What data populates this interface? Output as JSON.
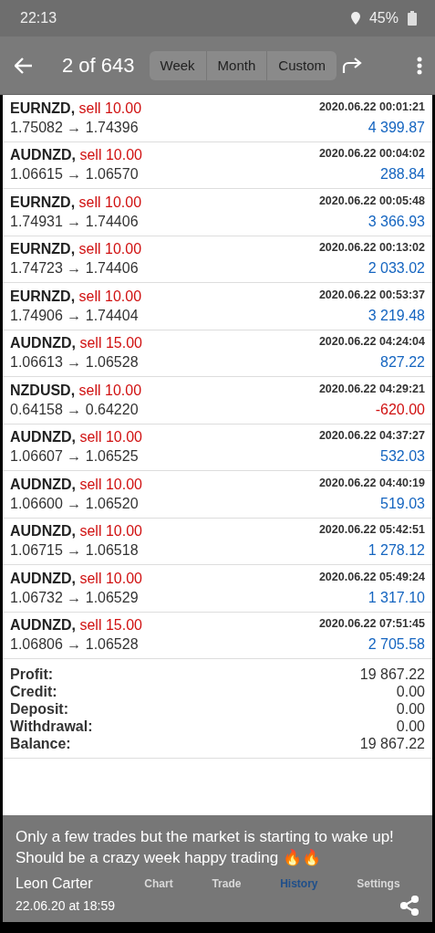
{
  "status_bar": {
    "time": "22:13",
    "battery": "45%"
  },
  "top_bar": {
    "counter": "2 of 643",
    "tabs": [
      {
        "label": "Week",
        "selected": false
      },
      {
        "label": "Month",
        "selected": false
      },
      {
        "label": "Custom",
        "selected": false
      }
    ]
  },
  "trades": [
    {
      "symbol": "EURNZD,",
      "action": "sell 10.00",
      "prices": "1.75082 → 1.74396",
      "time": "2020.06.22 00:01:21",
      "profit": "4 399.87",
      "negative": false
    },
    {
      "symbol": "AUDNZD,",
      "action": "sell 10.00",
      "prices": "1.06615 → 1.06570",
      "time": "2020.06.22 00:04:02",
      "profit": "288.84",
      "negative": false
    },
    {
      "symbol": "EURNZD,",
      "action": "sell 10.00",
      "prices": "1.74931 → 1.74406",
      "time": "2020.06.22 00:05:48",
      "profit": "3 366.93",
      "negative": false
    },
    {
      "symbol": "EURNZD,",
      "action": "sell 10.00",
      "prices": "1.74723 → 1.74406",
      "time": "2020.06.22 00:13:02",
      "profit": "2 033.02",
      "negative": false
    },
    {
      "symbol": "EURNZD,",
      "action": "sell 10.00",
      "prices": "1.74906 → 1.74404",
      "time": "2020.06.22 00:53:37",
      "profit": "3 219.48",
      "negative": false
    },
    {
      "symbol": "AUDNZD,",
      "action": "sell 15.00",
      "prices": "1.06613 → 1.06528",
      "time": "2020.06.22 04:24:04",
      "profit": "827.22",
      "negative": false
    },
    {
      "symbol": "NZDUSD,",
      "action": "sell 10.00",
      "prices": "0.64158 → 0.64220",
      "time": "2020.06.22 04:29:21",
      "profit": "-620.00",
      "negative": true
    },
    {
      "symbol": "AUDNZD,",
      "action": "sell 10.00",
      "prices": "1.06607 → 1.06525",
      "time": "2020.06.22 04:37:27",
      "profit": "532.03",
      "negative": false
    },
    {
      "symbol": "AUDNZD,",
      "action": "sell 10.00",
      "prices": "1.06600 → 1.06520",
      "time": "2020.06.22 04:40:19",
      "profit": "519.03",
      "negative": false
    },
    {
      "symbol": "AUDNZD,",
      "action": "sell 10.00",
      "prices": "1.06715 → 1.06518",
      "time": "2020.06.22 05:42:51",
      "profit": "1 278.12",
      "negative": false
    },
    {
      "symbol": "AUDNZD,",
      "action": "sell 10.00",
      "prices": "1.06732 → 1.06529",
      "time": "2020.06.22 05:49:24",
      "profit": "1 317.10",
      "negative": false
    },
    {
      "symbol": "AUDNZD,",
      "action": "sell 15.00",
      "prices": "1.06806 → 1.06528",
      "time": "2020.06.22 07:51:45",
      "profit": "2 705.58",
      "negative": false
    }
  ],
  "summary": [
    {
      "label": "Profit:",
      "value": "19 867.22"
    },
    {
      "label": "Credit:",
      "value": "0.00"
    },
    {
      "label": "Deposit:",
      "value": "0.00"
    },
    {
      "label": "Withdrawal:",
      "value": "0.00"
    },
    {
      "label": "Balance:",
      "value": "19 867.22"
    }
  ],
  "bottom_nav": [
    {
      "label": "Chart",
      "selected": false
    },
    {
      "label": "Trade",
      "selected": false
    },
    {
      "label": "History",
      "selected": true
    },
    {
      "label": "Settings",
      "selected": false
    }
  ],
  "post": {
    "caption": "Only a few trades but the market is starting to wake up! Should be a crazy week happy trading 🔥🔥",
    "author": "Leon Carter",
    "date": "22.06.20 at 18:59"
  }
}
